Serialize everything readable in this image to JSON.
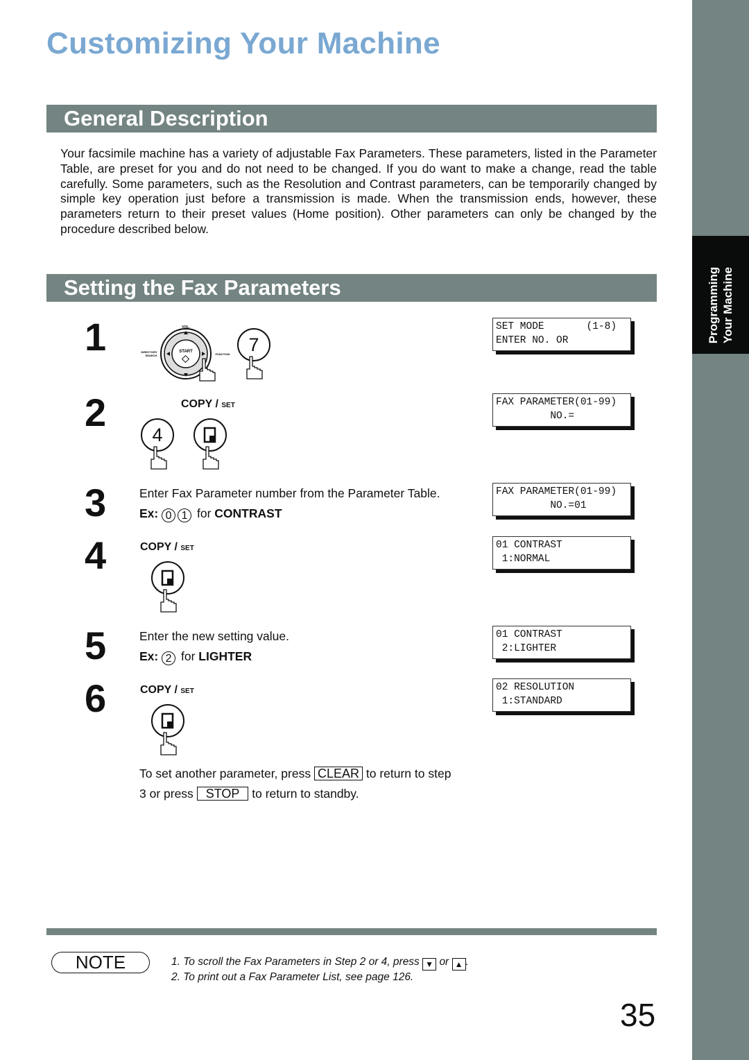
{
  "page_title": "Customizing Your Machine",
  "side_tab": {
    "line1": "Programming",
    "line2": "Your Machine"
  },
  "sections": {
    "general": {
      "title": "General Description",
      "body": "Your facsimile machine has a variety of adjustable Fax Parameters. These parameters, listed in the Parameter Table, are preset for you and do not need to be changed. If you do want to make a change, read the table carefully. Some parameters, such as the Resolution and Contrast parameters, can be temporarily changed by simple key operation just before a transmission is made. When the transmission ends, however, these parameters return to their preset values (Home position). Other parameters can only be changed by the procedure described below."
    },
    "setting": {
      "title": "Setting the  Fax Parameters"
    }
  },
  "control_panel": {
    "vol": "VOL.",
    "start": "START",
    "directory": "DIRECTORY",
    "search": "SEARCH",
    "function": "FUNCTION"
  },
  "copy_set": {
    "main": "COPY / ",
    "small": "SET"
  },
  "steps": [
    {
      "num": "1",
      "key": "7",
      "lcd": [
        "SET MODE       (1-8)",
        "ENTER NO. OR"
      ]
    },
    {
      "num": "2",
      "key": "4",
      "lcd": [
        "FAX PARAMETER(01-99)",
        "         NO.="
      ]
    },
    {
      "num": "3",
      "text": "Enter Fax Parameter number from the Parameter Table.",
      "ex_label": "Ex:",
      "ex_keys": [
        "0",
        "1"
      ],
      "ex_for": "for",
      "ex_value": "CONTRAST",
      "lcd": [
        "FAX PARAMETER(01-99)",
        "         NO.=01"
      ]
    },
    {
      "num": "4",
      "lcd": [
        "01 CONTRAST",
        " 1:NORMAL"
      ]
    },
    {
      "num": "5",
      "text": "Enter the new setting value.",
      "ex_label": "Ex:",
      "ex_keys": [
        "2"
      ],
      "ex_for": "for",
      "ex_value": "LIGHTER",
      "lcd": [
        "01 CONTRAST",
        " 2:LIGHTER"
      ]
    },
    {
      "num": "6",
      "lcd": [
        "02 RESOLUTION",
        " 1:STANDARD"
      ]
    }
  ],
  "footer_text": {
    "line1_a": "To set another parameter, press",
    "clear_key": "CLEAR",
    "line1_b": "to return to step",
    "line2_a": "3 or press",
    "stop_key": "STOP",
    "line2_b": "to return to standby."
  },
  "note": {
    "label": "NOTE",
    "items": [
      {
        "prefix": "1.  To scroll the Fax Parameters in Step 2 or 4, press",
        "key_down": "▼",
        "or": "or",
        "key_up": "▲",
        "suffix": "."
      },
      {
        "prefix": "2.  To print out a Fax Parameter List, see page 126."
      }
    ]
  },
  "page_number": "35",
  "colors": {
    "accent_title": "#7aa8d2",
    "bar_gray": "#738482",
    "tab_black": "#0a0c0c"
  }
}
